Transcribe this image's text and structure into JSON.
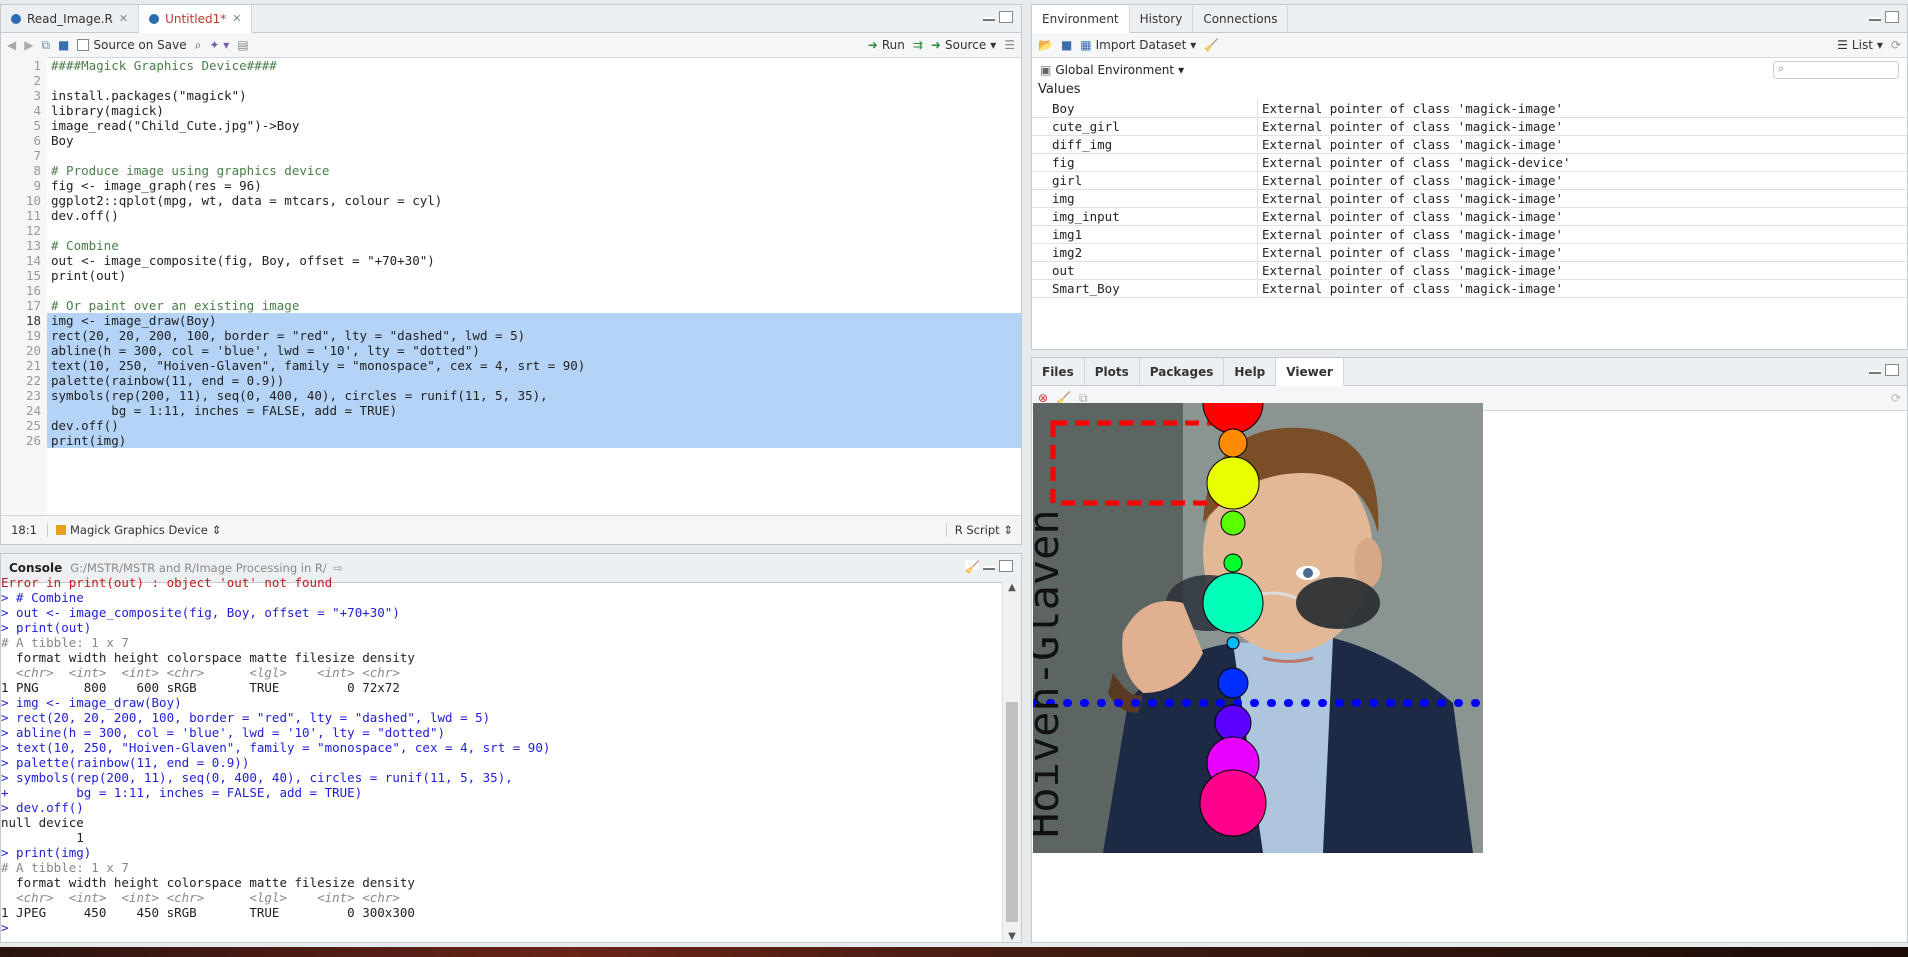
{
  "editor": {
    "tabs": [
      {
        "label": "Read_Image.R"
      },
      {
        "label": "Untitled1*"
      }
    ],
    "toolbar": {
      "source_on_save": "Source on Save",
      "run": "Run",
      "source": "Source"
    },
    "line_numbers": [
      "1",
      "2",
      "3",
      "4",
      "5",
      "6",
      "7",
      "8",
      "9",
      "10",
      "11",
      "12",
      "13",
      "14",
      "15",
      "16",
      "17",
      "18",
      "19",
      "20",
      "21",
      "22",
      "23",
      "24",
      "25",
      "26"
    ],
    "lines": [
      "####Magick Graphics Device####",
      "",
      "install.packages(\"magick\")",
      "library(magick)",
      "image_read(\"Child_Cute.jpg\")->Boy",
      "Boy",
      "",
      "# Produce image using graphics device",
      "fig <- image_graph(res = 96)",
      "ggplot2::qplot(mpg, wt, data = mtcars, colour = cyl)",
      "dev.off()",
      "",
      "# Combine",
      "out <- image_composite(fig, Boy, offset = \"+70+30\")",
      "print(out)",
      "",
      "# Or paint over an existing image",
      "img <- image_draw(Boy)",
      "rect(20, 20, 200, 100, border = \"red\", lty = \"dashed\", lwd = 5)",
      "abline(h = 300, col = 'blue', lwd = '10', lty = \"dotted\")",
      "text(10, 250, \"Hoiven-Glaven\", family = \"monospace\", cex = 4, srt = 90)",
      "palette(rainbow(11, end = 0.9))",
      "symbols(rep(200, 11), seq(0, 400, 40), circles = runif(11, 5, 35),",
      "        bg = 1:11, inches = FALSE, add = TRUE)",
      "dev.off()",
      "print(img)"
    ],
    "status": {
      "position": "18:1",
      "scope": "Magick Graphics Device",
      "filetype": "R Script"
    }
  },
  "console": {
    "title": "Console",
    "path": "G:/MSTR/MSTR and R/Image Processing in R/",
    "lines": [
      {
        "t": "Error in print(out) : object 'out' not found",
        "c": "red"
      },
      {
        "t": "> # Combine",
        "c": "blue"
      },
      {
        "t": "> out <- image_composite(fig, Boy, offset = \"+70+30\")",
        "c": "blue"
      },
      {
        "t": "> print(out)",
        "c": "blue"
      },
      {
        "t": "# A tibble: 1 x 7",
        "c": "gray"
      },
      {
        "t": "  format width height colorspace matte filesize density",
        "c": "black"
      },
      {
        "t": "  <chr>  <int>  <int> <chr>      <lgl>    <int> <chr>",
        "c": "ital"
      },
      {
        "t": "1 PNG      800    600 sRGB       TRUE         0 72x72",
        "c": "black"
      },
      {
        "t": "> img <- image_draw(Boy)",
        "c": "blue"
      },
      {
        "t": "> rect(20, 20, 200, 100, border = \"red\", lty = \"dashed\", lwd = 5)",
        "c": "blue"
      },
      {
        "t": "> abline(h = 300, col = 'blue', lwd = '10', lty = \"dotted\")",
        "c": "blue"
      },
      {
        "t": "> text(10, 250, \"Hoiven-Glaven\", family = \"monospace\", cex = 4, srt = 90)",
        "c": "blue"
      },
      {
        "t": "> palette(rainbow(11, end = 0.9))",
        "c": "blue"
      },
      {
        "t": "> symbols(rep(200, 11), seq(0, 400, 40), circles = runif(11, 5, 35),",
        "c": "blue"
      },
      {
        "t": "+         bg = 1:11, inches = FALSE, add = TRUE)",
        "c": "blue"
      },
      {
        "t": "> dev.off()",
        "c": "blue"
      },
      {
        "t": "null device",
        "c": "black"
      },
      {
        "t": "          1",
        "c": "black"
      },
      {
        "t": "> print(img)",
        "c": "blue"
      },
      {
        "t": "# A tibble: 1 x 7",
        "c": "gray"
      },
      {
        "t": "  format width height colorspace matte filesize density",
        "c": "black"
      },
      {
        "t": "  <chr>  <int>  <int> <chr>      <lgl>    <int> <chr>",
        "c": "ital"
      },
      {
        "t": "1 JPEG     450    450 sRGB       TRUE         0 300x300",
        "c": "black"
      },
      {
        "t": "> ",
        "c": "blue"
      }
    ]
  },
  "environment": {
    "tabs": [
      "Environment",
      "History",
      "Connections"
    ],
    "import_dataset": "Import Dataset",
    "list_view": "List",
    "scope": "Global Environment",
    "section": "Values",
    "rows": [
      {
        "name": "Boy",
        "value": "External pointer of class 'magick-image'"
      },
      {
        "name": "cute_girl",
        "value": "External pointer of class 'magick-image'"
      },
      {
        "name": "diff_img",
        "value": "External pointer of class 'magick-image'"
      },
      {
        "name": "fig",
        "value": "External pointer of class 'magick-device'"
      },
      {
        "name": "girl",
        "value": "External pointer of class 'magick-image'"
      },
      {
        "name": "img",
        "value": "External pointer of class 'magick-image'"
      },
      {
        "name": "img_input",
        "value": "External pointer of class 'magick-image'"
      },
      {
        "name": "img1",
        "value": "External pointer of class 'magick-image'"
      },
      {
        "name": "img2",
        "value": "External pointer of class 'magick-image'"
      },
      {
        "name": "out",
        "value": "External pointer of class 'magick-image'"
      },
      {
        "name": "Smart_Boy",
        "value": "External pointer of class 'magick-image'"
      }
    ]
  },
  "viewer": {
    "tabs": [
      "Files",
      "Plots",
      "Packages",
      "Help",
      "Viewer"
    ],
    "overlay_text": "Hoiven-Glaven",
    "circle_colors": [
      "#FF0000",
      "#FF8C00",
      "#E8FF00",
      "#5CFF00",
      "#00FF2E",
      "#00FFB9",
      "#00BAFF",
      "#002EFF",
      "#5C00FF",
      "#E800FF",
      "#FF008C"
    ]
  }
}
